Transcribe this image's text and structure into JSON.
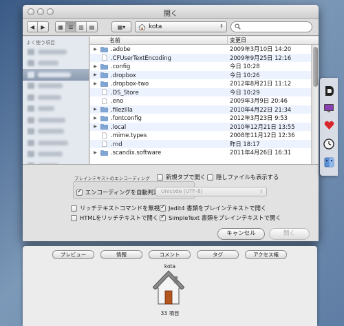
{
  "window": {
    "title": "開く"
  },
  "toolbar": {
    "path_label": "kota",
    "search_placeholder": ""
  },
  "sidebar": {
    "header": "よく使う項目"
  },
  "columns": {
    "name": "名前",
    "date": "変更日"
  },
  "files": [
    {
      "name": ".adobe",
      "date": "2009年3月10日 14:20",
      "folder": true
    },
    {
      "name": ".CFUserTextEncoding",
      "date": "2009年9月25日 12:16",
      "folder": false
    },
    {
      "name": ".config",
      "date": "今日 10:28",
      "folder": true
    },
    {
      "name": ".dropbox",
      "date": "今日 10:26",
      "folder": true
    },
    {
      "name": ".dropbox-two",
      "date": "2012年8月21日 11:12",
      "folder": true
    },
    {
      "name": ".DS_Store",
      "date": "今日 10:29",
      "folder": false
    },
    {
      "name": ".eno",
      "date": "2009年3月9日 20:46",
      "folder": false
    },
    {
      "name": ".filezilla",
      "date": "2010年4月22日 21:34",
      "folder": true
    },
    {
      "name": ".fontconfig",
      "date": "2012年3月23日 9:53",
      "folder": true
    },
    {
      "name": ".local",
      "date": "2010年12月21日 13:55",
      "folder": true
    },
    {
      "name": ".mime.types",
      "date": "2008年11月12日 12:36",
      "folder": false
    },
    {
      "name": ".rnd",
      "date": "昨日 18:17",
      "folder": false
    },
    {
      "name": ".scandix.software",
      "date": "2011年4月26日 16:31",
      "folder": true
    }
  ],
  "options": {
    "group_label": "プレインテキストのエンコーディング",
    "auto_encoding": "エンコーディングを自動判定",
    "encoding_value": "Unicode (UTF-8)",
    "new_tab": "新規タブで開く",
    "show_hidden": "隠しファイルも表示する",
    "ignore_rich": "リッチテキストコマンドを無視",
    "html_rich": "HTMLをリッチテキストで開く",
    "jedit": "Jedit4 書類をプレインテキストで開く",
    "simpletext": "SimpleText 書類をプレインテキストで開く",
    "cancel": "キャンセル",
    "open": "開く"
  },
  "info": {
    "tabs": [
      "プレビュー",
      "情報",
      "コメント",
      "タグ",
      "アクセス権"
    ],
    "name": "kota",
    "item_count": "33 項目"
  }
}
